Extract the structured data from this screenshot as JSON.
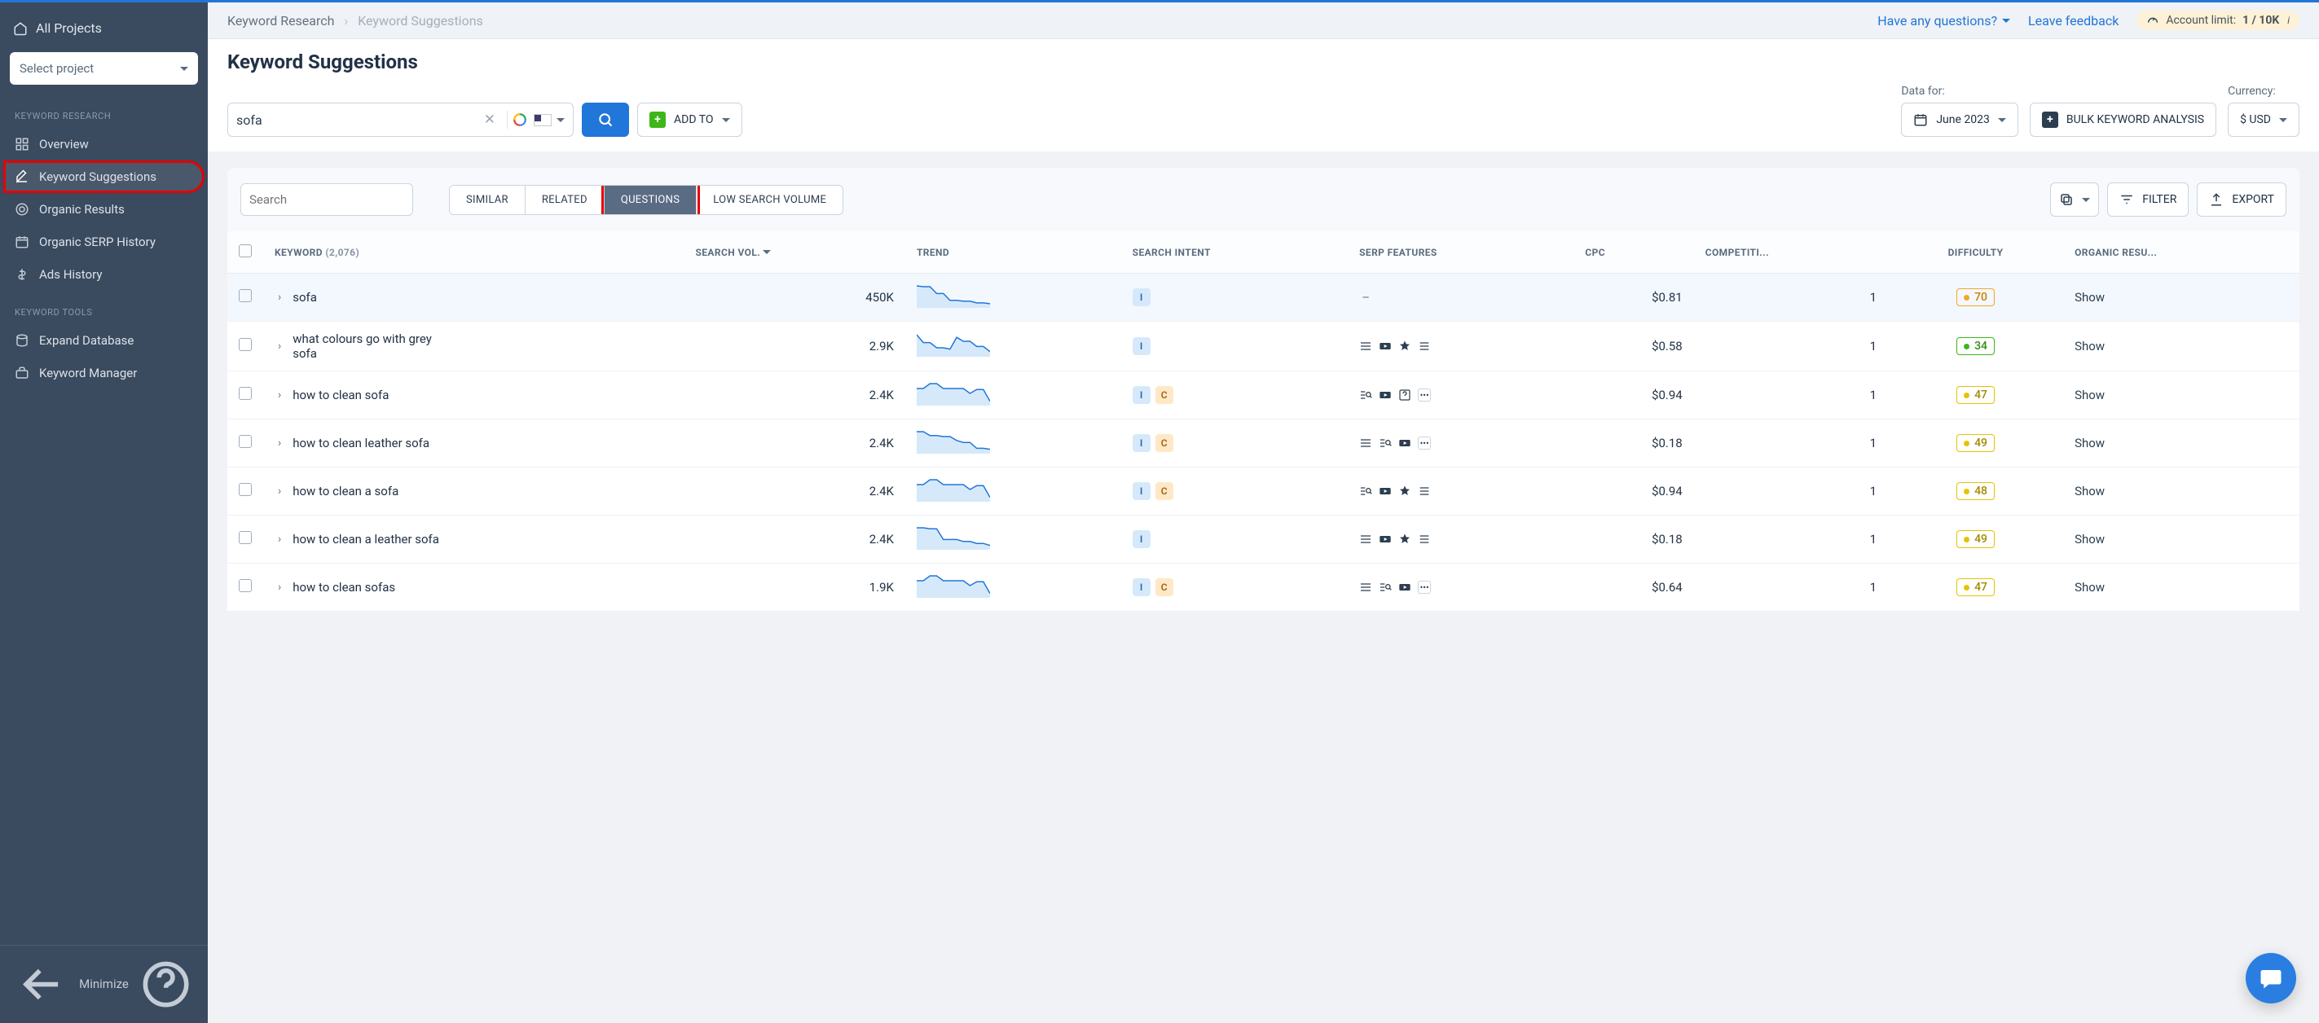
{
  "sidebar": {
    "all_projects": "All Projects",
    "select_project": "Select project",
    "section1": "KEYWORD RESEARCH",
    "items1": [
      {
        "label": "Overview"
      },
      {
        "label": "Keyword Suggestions"
      },
      {
        "label": "Organic Results"
      },
      {
        "label": "Organic SERP History"
      },
      {
        "label": "Ads History"
      }
    ],
    "section2": "KEYWORD TOOLS",
    "items2": [
      {
        "label": "Expand Database"
      },
      {
        "label": "Keyword Manager"
      }
    ],
    "minimize": "Minimize"
  },
  "topbar": {
    "crumb_root": "Keyword Research",
    "crumb_cur": "Keyword Suggestions",
    "questions": "Have any questions?",
    "feedback": "Leave feedback",
    "limit_label": "Account limit:",
    "limit_value": "1 / 10K"
  },
  "header": {
    "title": "Keyword Suggestions",
    "kw_value": "sofa",
    "add_to": "ADD TO",
    "data_for": "Data for:",
    "data_value": "June 2023",
    "bulk": "BULK KEYWORD ANALYSIS",
    "currency_label": "Currency:",
    "currency_value": "$ USD"
  },
  "toolbar": {
    "search_placeholder": "Search",
    "tabs": [
      "SIMILAR",
      "RELATED",
      "QUESTIONS",
      "LOW SEARCH VOLUME"
    ],
    "filter": "FILTER",
    "export": "EXPORT"
  },
  "table": {
    "cols": {
      "keyword": "KEYWORD",
      "count": "(2,076)",
      "vol": "SEARCH VOL.",
      "trend": "TREND",
      "intent": "SEARCH INTENT",
      "serp": "SERP FEATURES",
      "cpc": "CPC",
      "comp": "COMPETITI...",
      "diff": "DIFFICULTY",
      "organic": "ORGANIC RESU..."
    },
    "rows": [
      {
        "kw": "sofa",
        "vol": "450K",
        "trend": [
          29,
          28,
          28,
          20,
          20,
          12,
          12,
          11,
          11,
          9,
          9,
          8
        ],
        "intent": [
          "I"
        ],
        "serp": "dash",
        "cpc": "$0.81",
        "comp": "1",
        "diff": {
          "v": "70",
          "c": "orange"
        },
        "show": "Show"
      },
      {
        "kw": "what colours go with grey sofa",
        "vol": "2.9K",
        "trend": [
          20,
          14,
          14,
          10,
          10,
          9,
          18,
          15,
          15,
          11,
          11,
          7
        ],
        "intent": [
          "I"
        ],
        "serp": [
          "list",
          "video",
          "star",
          "lines"
        ],
        "cpc": "$0.58",
        "comp": "1",
        "diff": {
          "v": "34",
          "c": "green"
        },
        "show": "Show"
      },
      {
        "kw": "how to clean sofa",
        "vol": "2.4K",
        "trend": [
          22,
          22,
          27,
          27,
          22,
          22,
          22,
          22,
          17,
          21,
          21,
          9
        ],
        "intent": [
          "I",
          "C"
        ],
        "serp": [
          "search",
          "video",
          "faq",
          "more"
        ],
        "cpc": "$0.94",
        "comp": "1",
        "diff": {
          "v": "47",
          "c": "yellow"
        },
        "show": "Show"
      },
      {
        "kw": "how to clean leather sofa",
        "vol": "2.4K",
        "trend": [
          28,
          28,
          24,
          24,
          23,
          23,
          19,
          17,
          17,
          11,
          11,
          10
        ],
        "intent": [
          "I",
          "C"
        ],
        "serp": [
          "list",
          "search",
          "video",
          "more"
        ],
        "cpc": "$0.18",
        "comp": "1",
        "diff": {
          "v": "49",
          "c": "yellow"
        },
        "show": "Show"
      },
      {
        "kw": "how to clean a sofa",
        "vol": "2.4K",
        "trend": [
          22,
          22,
          27,
          27,
          22,
          22,
          22,
          22,
          17,
          21,
          21,
          9
        ],
        "intent": [
          "I",
          "C"
        ],
        "serp": [
          "search",
          "video",
          "star",
          "lines"
        ],
        "cpc": "$0.94",
        "comp": "1",
        "diff": {
          "v": "48",
          "c": "yellow"
        },
        "show": "Show"
      },
      {
        "kw": "how to clean a leather sofa",
        "vol": "2.4K",
        "trend": [
          28,
          28,
          27,
          27,
          16,
          16,
          16,
          14,
          14,
          12,
          12,
          10
        ],
        "intent": [
          "I"
        ],
        "serp": [
          "list",
          "video",
          "star",
          "lines"
        ],
        "cpc": "$0.18",
        "comp": "1",
        "diff": {
          "v": "49",
          "c": "yellow"
        },
        "show": "Show"
      },
      {
        "kw": "how to clean sofas",
        "vol": "1.9K",
        "trend": [
          22,
          22,
          27,
          27,
          22,
          22,
          22,
          22,
          17,
          21,
          21,
          9
        ],
        "intent": [
          "I",
          "C"
        ],
        "serp": [
          "list",
          "search",
          "video",
          "more"
        ],
        "cpc": "$0.64",
        "comp": "1",
        "diff": {
          "v": "47",
          "c": "yellow"
        },
        "show": "Show"
      }
    ]
  }
}
